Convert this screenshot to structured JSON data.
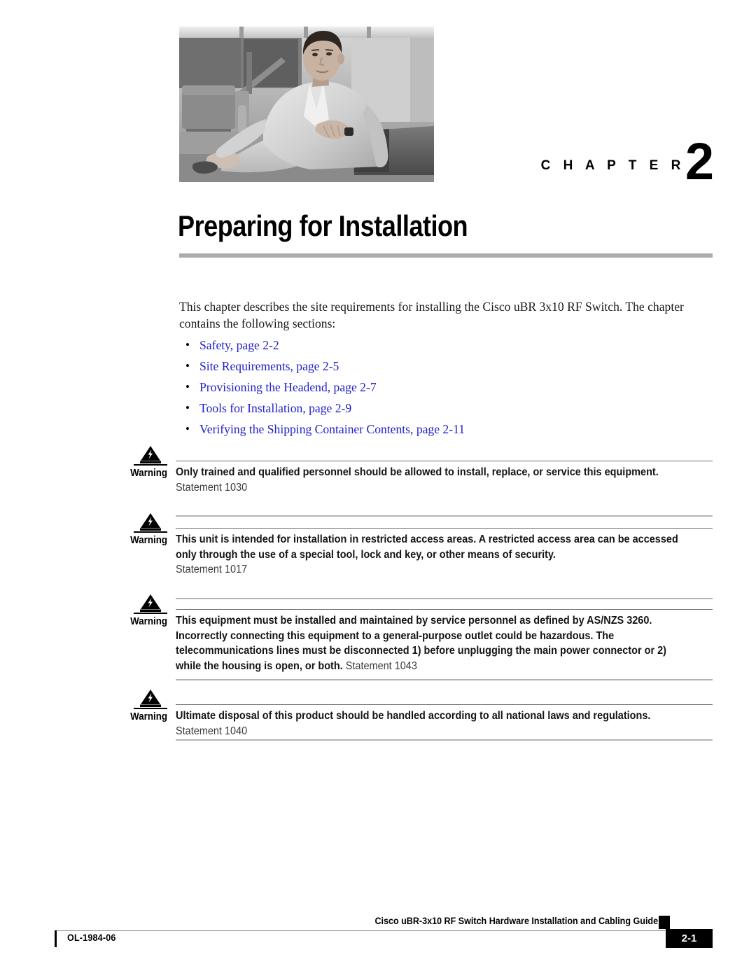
{
  "chapter": {
    "label_word": "C H A P T E R",
    "number": "2",
    "title": "Preparing for Installation"
  },
  "intro": {
    "paragraph": "This chapter describes the site requirements for installing the Cisco uBR 3x10 RF Switch. The chapter contains the following sections:"
  },
  "toc": {
    "items": [
      {
        "label": "Safety, page 2-2"
      },
      {
        "label": "Site Requirements, page 2-5"
      },
      {
        "label": "Provisioning the Headend, page 2-7"
      },
      {
        "label": "Tools for Installation, page 2-9"
      },
      {
        "label": "Verifying the Shipping Container Contents, page 2-11"
      }
    ]
  },
  "warnings": [
    {
      "label": "Warning",
      "icon": "warning-triangle-lightning-icon",
      "text": "Only trained and qualified personnel should be allowed to install, replace, or service this equipment.",
      "statement": "Statement 1030",
      "statement_inline": false
    },
    {
      "label": "Warning",
      "icon": "warning-triangle-lightning-icon",
      "text": "This unit is intended for installation in restricted access areas. A restricted access area can be accessed only through the use of a special tool, lock and key, or other means of security.",
      "statement": "Statement 1017",
      "statement_inline": false
    },
    {
      "label": "Warning",
      "icon": "warning-triangle-lightning-icon",
      "text": "This equipment must be installed and maintained by service personnel as defined by AS/NZS 3260. Incorrectly connecting this equipment to a general-purpose outlet could be hazardous. The telecommunications lines must be disconnected 1) before unplugging the main power connector or 2) while the housing is open, or both.",
      "statement": "Statement 1043",
      "statement_inline": true
    },
    {
      "label": "Warning",
      "icon": "warning-triangle-lightning-icon",
      "text": "Ultimate disposal of this product should be handled according to all national laws and regulations.",
      "statement": "Statement 1040",
      "statement_inline": false
    }
  ],
  "footer": {
    "doc_id": "OL-1984-06",
    "guide_title": "Cisco uBR-3x10 RF Switch Hardware Installation and Cabling Guide",
    "page_number": "2-1"
  },
  "colors": {
    "link_blue": "#2222cc",
    "title_rule_gray": "#acacac",
    "warn_rule_gray": "#b4b4b4",
    "footer_black": "#000000"
  }
}
